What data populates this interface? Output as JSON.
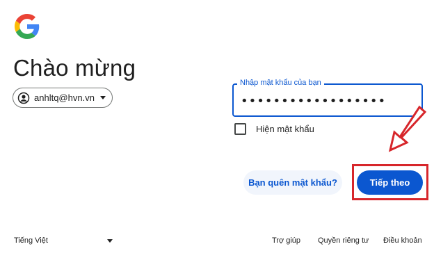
{
  "header": {
    "title": "Chào mừng"
  },
  "account": {
    "email": "anhltq@hvn.vn"
  },
  "password_field": {
    "label": "Nhập mật khẩu của bạn",
    "value": "••••••••••••••••••"
  },
  "show_password": {
    "label": "Hiện mật khẩu",
    "checked": false
  },
  "actions": {
    "forgot_label": "Bạn quên mật khẩu?",
    "next_label": "Tiếp theo"
  },
  "footer": {
    "language": "Tiếng Việt",
    "links": [
      "Trợ giúp",
      "Quyền riêng tư",
      "Điều khoản"
    ]
  },
  "colors": {
    "accent": "#0b57d0",
    "highlight": "#d7262b",
    "forgot_bg": "#f1f5fc"
  },
  "icons": {
    "logo": "google-g-logo",
    "avatar": "account-circle-icon",
    "arrow": "red-pointer-arrow"
  }
}
